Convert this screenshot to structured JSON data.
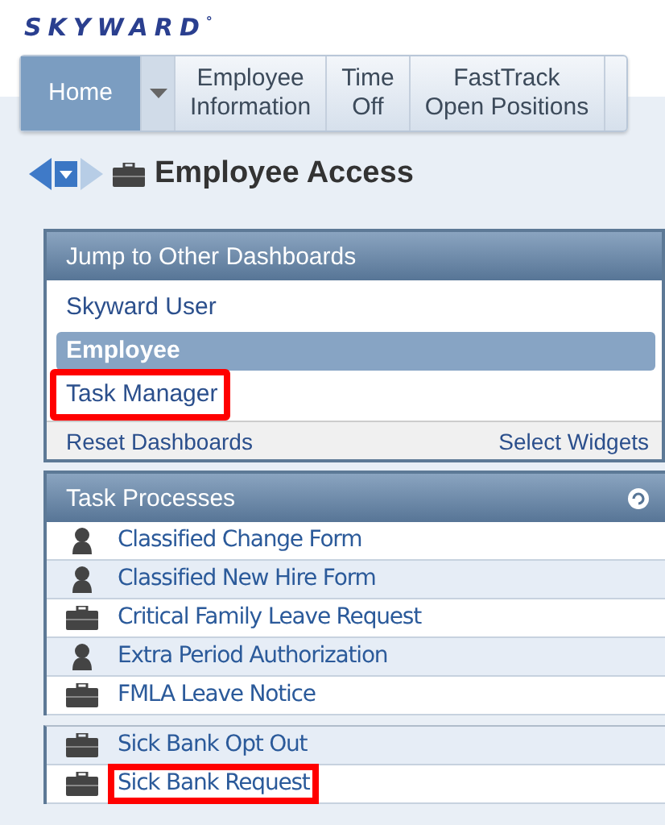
{
  "logo": {
    "text": "SKYWARD",
    "mark": "°"
  },
  "nav": {
    "tabs": [
      {
        "label": "Home",
        "selected": true,
        "has_menu": true
      },
      {
        "label": "Employee\nInformation",
        "selected": false,
        "has_menu": false
      },
      {
        "label": "Time\nOff",
        "selected": false,
        "has_menu": false
      },
      {
        "label": "FastTrack\nOpen Positions",
        "selected": false,
        "has_menu": false
      }
    ]
  },
  "page_title": "Employee Access",
  "dashboards": {
    "title": "Jump to Other Dashboards",
    "items": [
      {
        "label": "Skyward User",
        "selected": false,
        "highlighted": false
      },
      {
        "label": "Employee",
        "selected": true,
        "highlighted": false
      },
      {
        "label": "Task Manager",
        "selected": false,
        "highlighted": true
      }
    ],
    "footer": [
      "Reset Dashboards",
      "Select Widgets"
    ]
  },
  "tasks": {
    "title": "Task Processes",
    "groups": [
      [
        {
          "label": "Classified Change Form",
          "kind": "person",
          "highlighted": false
        },
        {
          "label": "Classified New Hire Form",
          "kind": "person",
          "highlighted": false
        },
        {
          "label": "Critical Family Leave Request",
          "kind": "briefcase",
          "highlighted": false
        },
        {
          "label": "Extra Period Authorization",
          "kind": "person",
          "highlighted": false
        },
        {
          "label": "FMLA Leave Notice",
          "kind": "briefcase",
          "highlighted": false
        }
      ],
      [
        {
          "label": "Sick Bank Opt Out",
          "kind": "briefcase",
          "highlighted": false
        },
        {
          "label": "Sick Bank Request",
          "kind": "briefcase",
          "highlighted": true
        }
      ]
    ]
  }
}
